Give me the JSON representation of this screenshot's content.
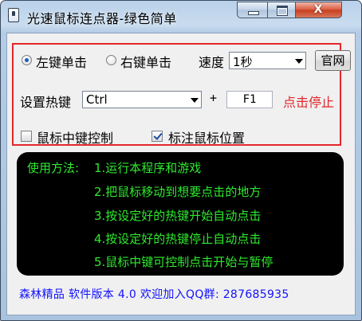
{
  "window": {
    "title": "光速鼠标连点器-绿色简单",
    "close_glyph": "X"
  },
  "options": {
    "left_click_label": "左键单击",
    "left_click_checked": true,
    "right_click_label": "右键单击",
    "right_click_checked": false,
    "speed_label": "速度",
    "speed_value": "1秒",
    "website_button": "官网"
  },
  "hotkey": {
    "label": "设置热键",
    "modifier_value": "Ctrl",
    "plus": "+",
    "key_value": "F1",
    "status_text": "点击停止"
  },
  "checks": {
    "middle_button_label": "鼠标中键控制",
    "middle_button_checked": false,
    "mark_position_label": "标注鼠标位置",
    "mark_position_checked": true
  },
  "instructions": {
    "heading": "使用方法:",
    "steps": [
      "1.运行本程序和游戏",
      "2.把鼠标移动到想要点击的地方",
      "3.按设定好的热键开始自动点击",
      "4.按设定好的热键停止自动点击",
      "5.鼠标中键可控制点击开始与暂停"
    ]
  },
  "footer": {
    "text": "森林精品 软件版本 4.0 欢迎加入QQ群: 287685935"
  },
  "colors": {
    "instruction_text": "#2ee92e",
    "status_text": "#e3262b",
    "footer_text": "#1212ff",
    "highlight_border": "#e3262b"
  },
  "icons": {
    "app": "app-icon",
    "minimize": "minimize-icon",
    "maximize": "maximize-icon",
    "close": "close-icon",
    "dropdown": "chevron-down-icon"
  }
}
